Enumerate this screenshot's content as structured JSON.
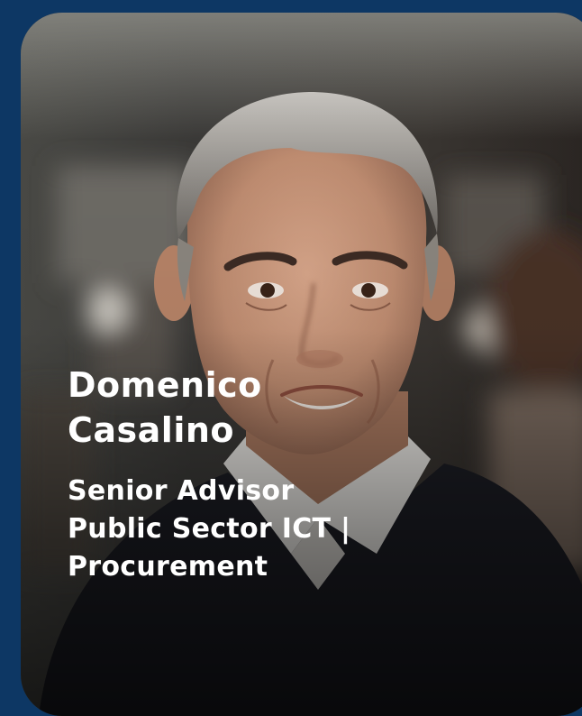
{
  "profile": {
    "name_lines": [
      "Domenico",
      "Casalino"
    ],
    "role_lines": [
      "Senior Advisor",
      "Public Sector ICT |",
      "Procurement"
    ]
  },
  "colors": {
    "background": "#0d3764",
    "text": "#ffffff"
  }
}
